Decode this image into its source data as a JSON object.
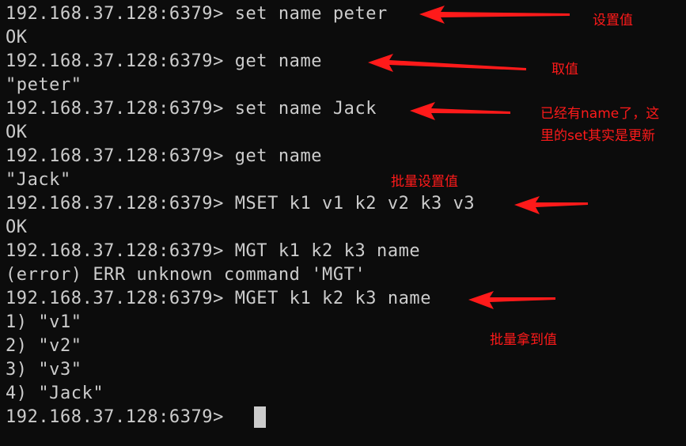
{
  "colors": {
    "background": "#0c0c0c",
    "text": "#cccccc",
    "annotation": "#ff1a1a"
  },
  "terminal": {
    "lines": [
      "192.168.37.128:6379> set name peter",
      "OK",
      "192.168.37.128:6379> get name",
      "\"peter\"",
      "192.168.37.128:6379> set name Jack",
      "OK",
      "192.168.37.128:6379> get name",
      "\"Jack\"",
      "192.168.37.128:6379> MSET k1 v1 k2 v2 k3 v3",
      "OK",
      "192.168.37.128:6379> MGT k1 k2 k3 name",
      "(error) ERR unknown command 'MGT'",
      "192.168.37.128:6379> MGET k1 k2 k3 name",
      "1) \"v1\"",
      "2) \"v2\"",
      "3) \"v3\"",
      "4) \"Jack\"",
      "192.168.37.128:6379> "
    ]
  },
  "annotations": {
    "set_value": "设置值",
    "get_value": "取值",
    "update_line1": "已经有name了，这",
    "update_line2": "里的set其实是更新",
    "batch_set": "批量设置值",
    "batch_get": "批量拿到值"
  }
}
